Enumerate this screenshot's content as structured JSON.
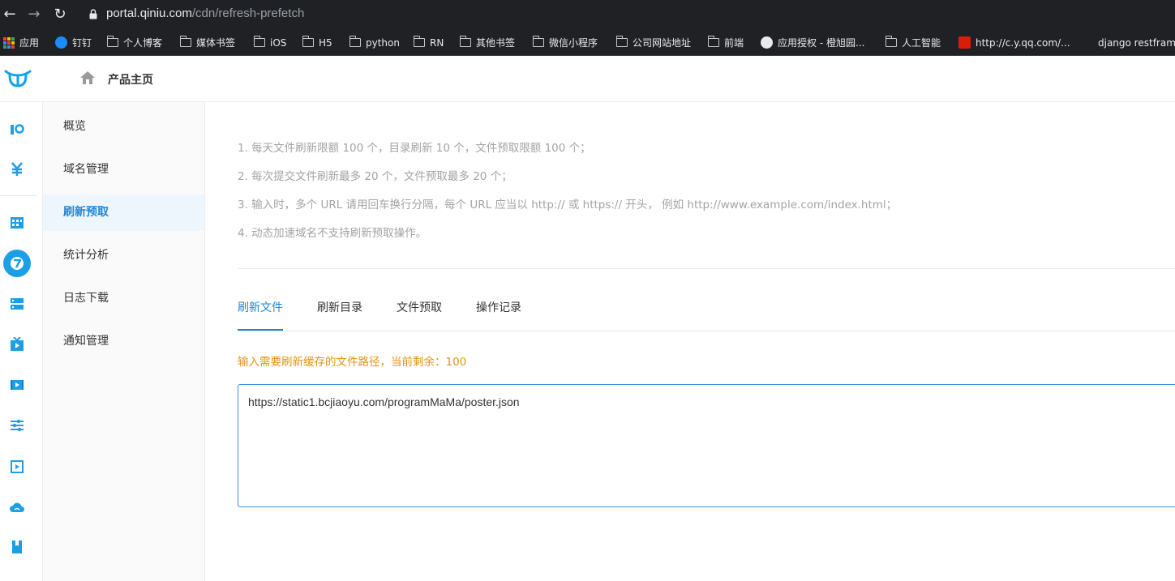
{
  "browser": {
    "url_host": "portal.qiniu.com",
    "url_path": "/cdn/refresh-prefetch",
    "bookmarks": [
      {
        "label": "应用",
        "icon": "apps-grid-icon"
      },
      {
        "label": "钉钉",
        "icon": "dingtalk-icon"
      },
      {
        "label": "个人博客",
        "icon": "folder-icon"
      },
      {
        "label": "媒体书签",
        "icon": "folder-icon"
      },
      {
        "label": "iOS",
        "icon": "folder-icon"
      },
      {
        "label": "H5",
        "icon": "folder-icon"
      },
      {
        "label": "python",
        "icon": "folder-icon"
      },
      {
        "label": "RN",
        "icon": "folder-icon"
      },
      {
        "label": "其他书签",
        "icon": "folder-icon"
      },
      {
        "label": "微信小程序",
        "icon": "folder-icon"
      },
      {
        "label": "公司网站地址",
        "icon": "folder-icon"
      },
      {
        "label": "前端",
        "icon": "folder-icon"
      },
      {
        "label": "应用授权 - 橙旭园...",
        "icon": "globe-icon"
      },
      {
        "label": "人工智能",
        "icon": "folder-icon"
      },
      {
        "label": "http://c.y.qq.com/...",
        "icon": "red-site-icon"
      },
      {
        "label": "django restfram",
        "icon": "page-icon"
      }
    ]
  },
  "header": {
    "home_title": "产品主页"
  },
  "rail": {
    "icons": [
      "kodo-icon",
      "yen-icon",
      "dashboard-icon",
      "cdn-icon",
      "server-icon",
      "live-icon",
      "video-icon",
      "settings-sliders-icon",
      "media-player-icon",
      "cloud-icon",
      "bookmark-icon"
    ],
    "accent": "#1c9fe5"
  },
  "submenu": {
    "items": [
      {
        "label": "概览"
      },
      {
        "label": "域名管理"
      },
      {
        "label": "刷新预取"
      },
      {
        "label": "统计分析"
      },
      {
        "label": "日志下载"
      },
      {
        "label": "通知管理"
      }
    ],
    "active_index": 2
  },
  "notes": [
    "1. 每天文件刷新限额 100 个，目录刷新 10 个，文件预取限额 100 个；",
    "2. 每次提交文件刷新最多 20 个，文件预取最多 20 个；",
    "3. 输入时，多个 URL 请用回车换行分隔，每个 URL 应当以 http:// 或 https:// 开头， 例如 http://www.example.com/index.html；",
    "4. 动态加速域名不支持刷新预取操作。"
  ],
  "tabs": [
    {
      "label": "刷新文件"
    },
    {
      "label": "刷新目录"
    },
    {
      "label": "文件预取"
    },
    {
      "label": "操作记录"
    }
  ],
  "active_tab": 0,
  "hint": "输入需要刷新缓存的文件路径，当前剩余：100",
  "urls_input": {
    "value": "https://static1.bcjiaoyu.com/programMaMa/poster.json"
  },
  "colors": {
    "primary": "#1f86d6",
    "warning": "#e0950f"
  }
}
